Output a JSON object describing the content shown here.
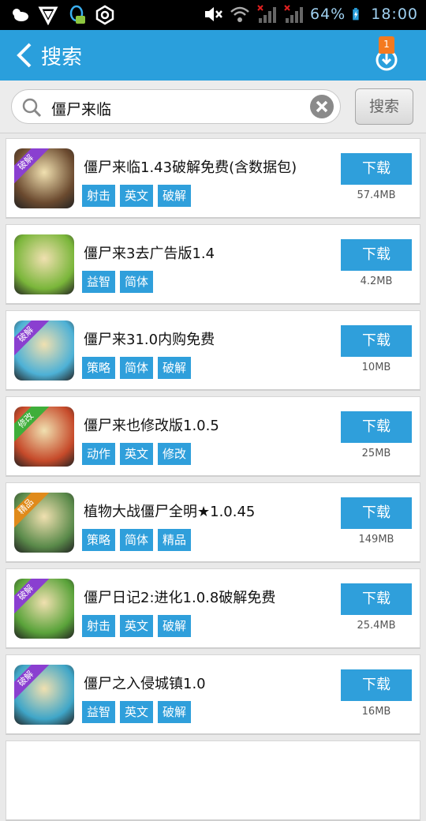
{
  "status_bar": {
    "battery": "64%",
    "time": "18:00"
  },
  "header": {
    "title": "搜索",
    "download_badge": "1"
  },
  "search": {
    "value": "僵尸来临",
    "button_label": "搜索"
  },
  "icons": {
    "back": "chevron-left-icon",
    "download_manager": "download-circle-icon",
    "search": "magnifier-icon",
    "clear": "close-circle-icon"
  },
  "colors": {
    "accent": "#2a9fdc",
    "tag": "#2f9fdb",
    "badge": "#f47a1f"
  },
  "apps": [
    {
      "name": "僵尸来临1.43破解免费(含数据包)",
      "tags": [
        "射击",
        "英文",
        "破解"
      ],
      "download_label": "下载",
      "size": "57.4MB",
      "ribbon": "破解",
      "ribbon_color": "#8a3fd0",
      "icon_bg": "#6b4a2f"
    },
    {
      "name": "僵尸来3去广告版1.4",
      "tags": [
        "益智",
        "简体"
      ],
      "download_label": "下载",
      "size": "4.2MB",
      "ribbon": "",
      "ribbon_color": "",
      "icon_bg": "#7ab63a"
    },
    {
      "name": "僵尸来31.0内购免费",
      "tags": [
        "策略",
        "简体",
        "破解"
      ],
      "download_label": "下载",
      "size": "10MB",
      "ribbon": "破解",
      "ribbon_color": "#8a3fd0",
      "icon_bg": "#4db1d6"
    },
    {
      "name": "僵尸来也修改版1.0.5",
      "tags": [
        "动作",
        "英文",
        "修改"
      ],
      "download_label": "下载",
      "size": "25MB",
      "ribbon": "修改",
      "ribbon_color": "#3fae3a",
      "icon_bg": "#c64a2a"
    },
    {
      "name": "植物大战僵尸全明★1.0.45",
      "tags": [
        "策略",
        "简体",
        "精品"
      ],
      "download_label": "下载",
      "size": "149MB",
      "ribbon": "精品",
      "ribbon_color": "#e08a1a",
      "icon_bg": "#5a8a4a"
    },
    {
      "name": "僵尸日记2:进化1.0.8破解免费",
      "tags": [
        "射击",
        "英文",
        "破解"
      ],
      "download_label": "下载",
      "size": "25.4MB",
      "ribbon": "破解",
      "ribbon_color": "#8a3fd0",
      "icon_bg": "#5aa33a"
    },
    {
      "name": "僵尸之入侵城镇1.0",
      "tags": [
        "益智",
        "英文",
        "破解"
      ],
      "download_label": "下载",
      "size": "16MB",
      "ribbon": "破解",
      "ribbon_color": "#8a3fd0",
      "icon_bg": "#3fa6c8"
    }
  ]
}
